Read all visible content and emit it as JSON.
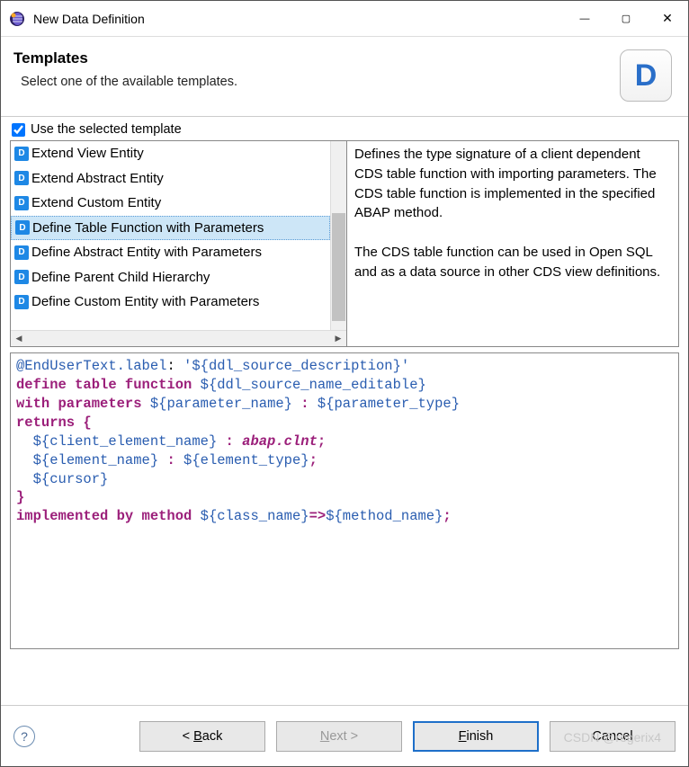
{
  "window": {
    "title": "New Data Definition"
  },
  "header": {
    "title": "Templates",
    "subtitle": "Select one of the available templates.",
    "logo_letter": "D"
  },
  "checkbox": {
    "label": "Use the selected template",
    "checked": true
  },
  "templates": [
    "Extend View Entity",
    "Extend Abstract Entity",
    "Extend Custom Entity",
    "Define Table Function with Parameters",
    "Define Abstract Entity with Parameters",
    "Define Parent Child Hierarchy",
    "Define Custom Entity with Parameters"
  ],
  "selected_index": 3,
  "description": {
    "p1": "Defines the type signature of a client dependent CDS table function with importing parameters. The CDS table function is implemented in the specified ABAP method.",
    "p2": "The CDS table function can be used in Open SQL and as a data source in other CDS view definitions."
  },
  "code": {
    "ann_label": "@EndUserText.label",
    "ann_sep": ": ",
    "ann_val": "'${ddl_source_description}'",
    "kw_define": "define table function",
    "src_name": "${ddl_source_name_editable}",
    "kw_with": "with parameters",
    "param_name": "${parameter_name}",
    "colon": " : ",
    "param_type": "${parameter_type}",
    "kw_returns": "returns",
    "brace_open": " {",
    "indent": "  ",
    "client_elem": "${client_element_name}",
    "abap_clnt": "abap.clnt",
    "semi": ";",
    "elem_name": "${element_name}",
    "elem_type": "${element_type}",
    "cursor": "${cursor}",
    "brace_close": "}",
    "kw_impl": "implemented by method",
    "class_name": "${class_name}",
    "arrow": "=>",
    "method_name": "${method_name}"
  },
  "buttons": {
    "back": "< Back",
    "next": "Next >",
    "finish": "Finish",
    "cancel": "Cancel"
  },
  "watermark": "CSDN @rogerix4"
}
